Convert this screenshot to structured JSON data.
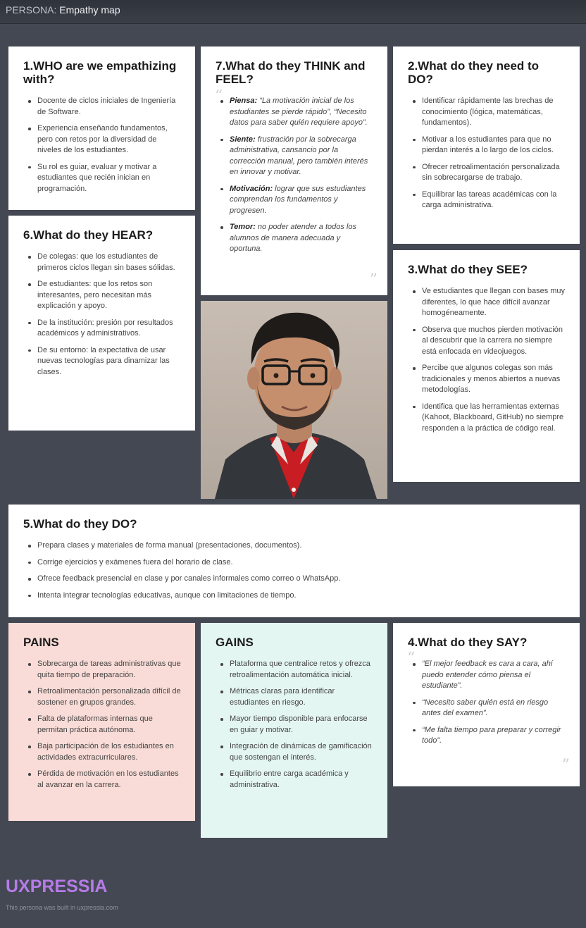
{
  "header": {
    "prefix": "PERSONA:",
    "title": "Empathy map"
  },
  "who": {
    "title": "1.WHO are we empathizing with?",
    "items": [
      "Docente de ciclos iniciales de Ingeniería de Software.",
      "Experiencia enseñando fundamentos, pero con retos por la diversidad de niveles de los estudiantes.",
      "Su rol es guiar, evaluar y motivar a estudiantes que recién inician en programación."
    ]
  },
  "think": {
    "title": "7.What do they THINK and FEEL?",
    "items": [
      {
        "label": "Piensa:",
        "text": " “La motivación inicial de los estudiantes se pierde rápido”, “Necesito datos para saber quién requiere apoyo”."
      },
      {
        "label": "Siente:",
        "text": " frustración por la sobrecarga administrativa, cansancio por la corrección manual, pero también interés en innovar y motivar."
      },
      {
        "label": "Motivación:",
        "text": " lograr que sus estudiantes comprendan los fundamentos y progresen."
      },
      {
        "label": "Temor:",
        "text": " no poder atender a todos los alumnos de manera adecuada y oportuna."
      }
    ]
  },
  "need": {
    "title": "2.What do they need to DO?",
    "items": [
      "Identificar rápidamente las brechas de conocimiento (lógica, matemáticas, fundamentos).",
      "Motivar a los estudiantes para que no pierdan interés a lo largo de los ciclos.",
      "Ofrecer retroalimentación personalizada sin sobrecargarse de trabajo.",
      "Equilibrar las tareas académicas con la carga administrativa."
    ]
  },
  "hear": {
    "title": "6.What do they HEAR?",
    "items": [
      "De colegas: que los estudiantes de primeros ciclos llegan sin bases sólidas.",
      "De estudiantes: que los retos son interesantes, pero necesitan más explicación y apoyo.",
      "De la institución: presión por resultados académicos y administrativos.",
      "De su entorno: la expectativa de usar nuevas tecnologías para dinamizar las clases."
    ]
  },
  "see": {
    "title": "3.What do they SEE?",
    "items": [
      "Ve estudiantes que llegan con bases muy diferentes, lo que hace difícil avanzar homogéneamente.",
      "Observa que muchos pierden motivación al descubrir que la carrera no siempre está enfocada en videojuegos.",
      "Percibe que algunos colegas son más tradicionales y menos abiertos a nuevas metodologías.",
      "Identifica que las herramientas externas (Kahoot, Blackboard, GitHub) no siempre responden a la práctica de código real."
    ]
  },
  "do": {
    "title": "5.What do they DO?",
    "items": [
      "Prepara clases y materiales de forma manual (presentaciones, documentos).",
      "Corrige ejercicios y exámenes fuera del horario de clase.",
      "Ofrece feedback presencial en clase y por canales informales como correo o WhatsApp.",
      "Intenta integrar tecnologías educativas, aunque con limitaciones de tiempo."
    ]
  },
  "pains": {
    "title": "PAINS",
    "items": [
      "Sobrecarga de tareas administrativas que quita tiempo de preparación.",
      "Retroalimentación personalizada difícil de sostener en grupos grandes.",
      "Falta de plataformas internas que permitan práctica autónoma.",
      "Baja participación de los estudiantes en actividades extracurriculares.",
      "Pérdida de motivación en los estudiantes al avanzar en la carrera."
    ]
  },
  "gains": {
    "title": "GAINS",
    "items": [
      "Plataforma que centralice retos y ofrezca retroalimentación automática inicial.",
      "Métricas claras para identificar estudiantes en riesgo.",
      "Mayor tiempo disponible para enfocarse en guiar y motivar.",
      "Integración de dinámicas de gamificación que sostengan el interés.",
      "Equilibrio entre carga académica y administrativa."
    ]
  },
  "say": {
    "title": "4.What do they SAY?",
    "items": [
      "“El mejor feedback es cara a cara, ahí puedo entender cómo piensa el estudiante”.",
      "“Necesito saber quién está en riesgo antes del examen”.",
      "“Me falta tiempo para preparar y corregir todo”."
    ]
  },
  "footer": {
    "logo": "UXPRESSIA",
    "note": "This persona was built in uxpressia.com"
  },
  "colors": {
    "background": "#434852",
    "pains_bg": "#f9dcd7",
    "gains_bg": "#e4f6f2",
    "logo": "#b67be8"
  }
}
